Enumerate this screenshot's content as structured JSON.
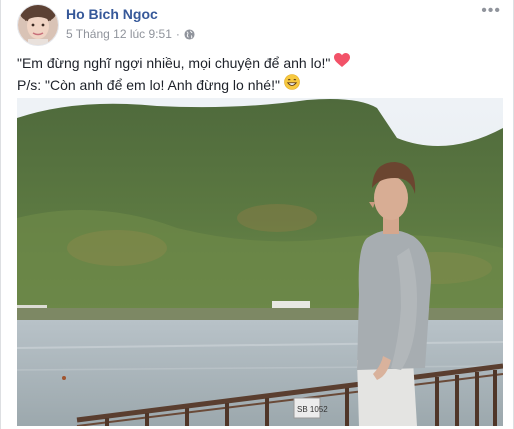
{
  "post": {
    "author": "Ho Bich Ngoc",
    "timestamp": "5 Tháng 12 lúc 9:51",
    "separator": "·",
    "privacy_icon": "globe-icon",
    "more_icon": "more-options-icon",
    "more_glyph": "•••",
    "line1": "\"Em đừng nghĩ ngợi nhiều, mọi chuyện để anh lo!\"",
    "line1_emoji": "pink-heart-icon",
    "line2": "P/s: \"Còn anh để em lo! Anh đừng lo nhé!\"",
    "line2_emoji": "grinning-face-icon",
    "photo_sign_text": "SB 1052"
  },
  "colors": {
    "author_link": "#365899",
    "meta_gray": "#90949c",
    "text": "#1d2129",
    "heart": "#f25268",
    "emoji_face": "#f7c940"
  }
}
